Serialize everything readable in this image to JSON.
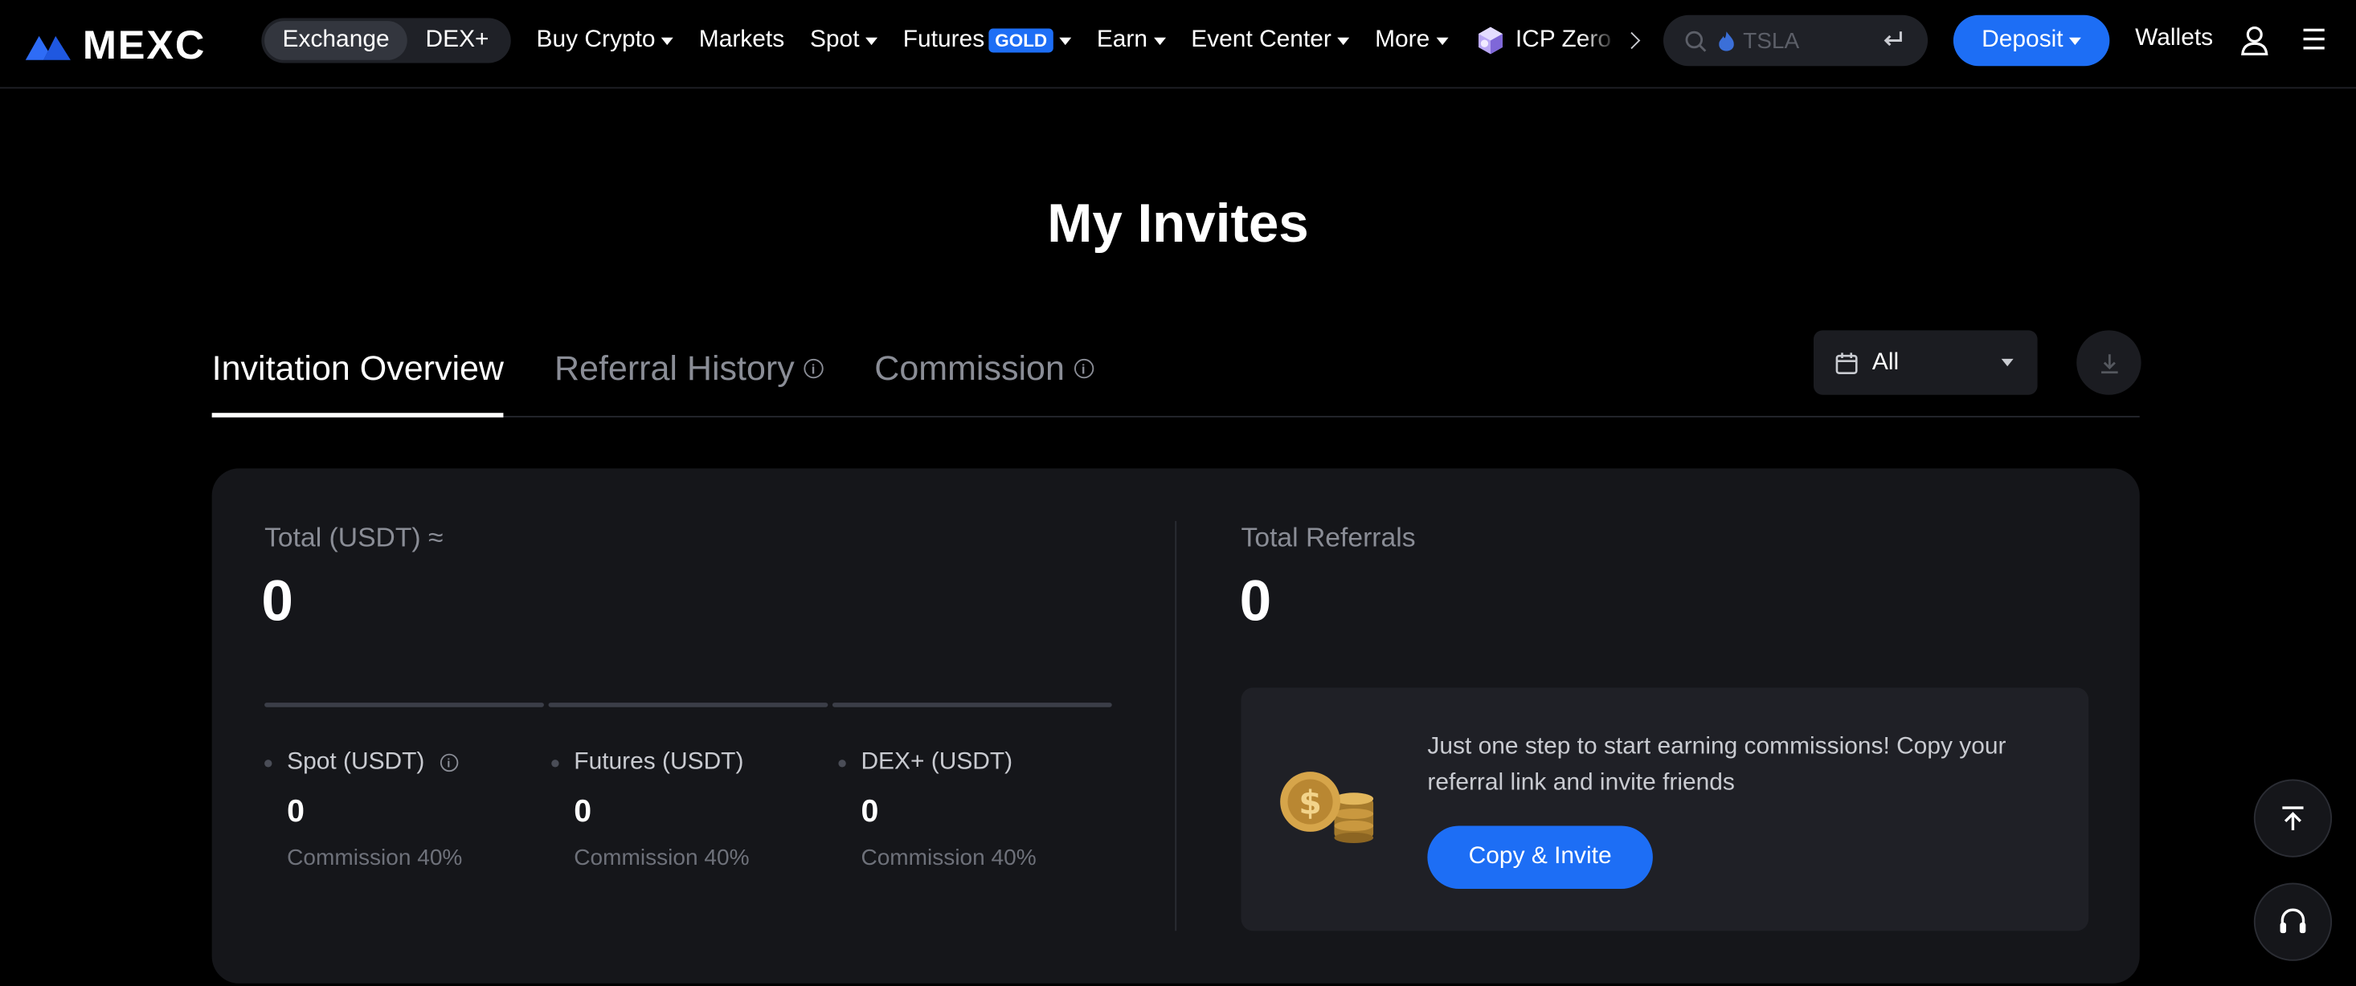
{
  "brand": {
    "name": "MEXC"
  },
  "switch": {
    "exchange": "Exchange",
    "dex": "DEX+"
  },
  "nav": {
    "buy_crypto": "Buy Crypto",
    "markets": "Markets",
    "spot": "Spot",
    "futures": "Futures",
    "futures_badge": "GOLD",
    "earn": "Earn",
    "event_center": "Event Center",
    "more": "More",
    "icp": "ICP Zero"
  },
  "search": {
    "placeholder": "TSLA"
  },
  "header_actions": {
    "deposit": "Deposit",
    "wallets": "Wallets"
  },
  "page": {
    "title": "My Invites"
  },
  "tabs": [
    {
      "label": "Invitation Overview",
      "active": true
    },
    {
      "label": "Referral History",
      "info": true
    },
    {
      "label": "Commission",
      "info": true
    }
  ],
  "filter": {
    "value": "All"
  },
  "summary": {
    "total_label": "Total (USDT) ≈",
    "total_value": "0",
    "referrals_label": "Total Referrals",
    "referrals_value": "0",
    "breakdown": [
      {
        "name": "Spot (USDT)",
        "value": "0",
        "commission": "Commission 40%",
        "info": true
      },
      {
        "name": "Futures (USDT)",
        "value": "0",
        "commission": "Commission 40%"
      },
      {
        "name": "DEX+ (USDT)",
        "value": "0",
        "commission": "Commission 40%"
      }
    ]
  },
  "promo": {
    "text": "Just one step to start earning commissions! Copy your referral link and invite friends",
    "button": "Copy & Invite"
  },
  "colors": {
    "accent": "#1d6ef5",
    "background": "#000000",
    "card": "#15161a"
  }
}
